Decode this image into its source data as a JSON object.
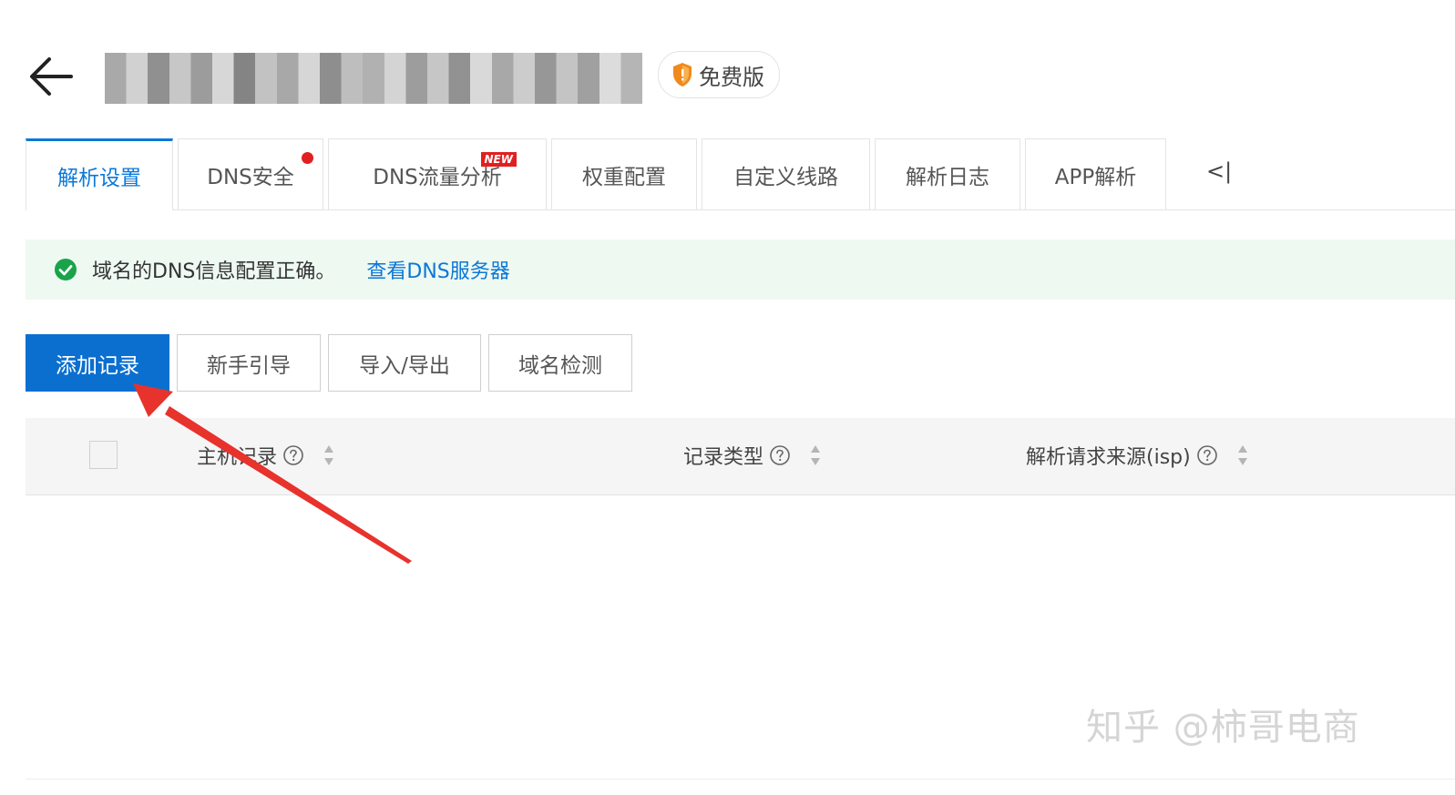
{
  "header": {
    "plan_badge": "免费版"
  },
  "tabs": [
    {
      "label": "解析设置"
    },
    {
      "label": "DNS安全"
    },
    {
      "label": "DNS流量分析",
      "badge": "NEW"
    },
    {
      "label": "权重配置"
    },
    {
      "label": "自定义线路"
    },
    {
      "label": "解析日志"
    },
    {
      "label": "APP解析"
    }
  ],
  "tab_collapse": "<|",
  "alert": {
    "message": "域名的DNS信息配置正确。",
    "link": "查看DNS服务器"
  },
  "toolbar": {
    "add": "添加记录",
    "guide": "新手引导",
    "import_export": "导入/导出",
    "check": "域名检测"
  },
  "table": {
    "columns": [
      "主机记录",
      "记录类型",
      "解析请求来源(isp)"
    ]
  },
  "watermark": "知乎 @柿哥电商",
  "colors": {
    "primary": "#0b6fd0",
    "link": "#0b78d8",
    "success": "#1aa34a",
    "alert_bg": "#eef9f1",
    "annotation": "#e8322c",
    "badge": "#e02020"
  }
}
